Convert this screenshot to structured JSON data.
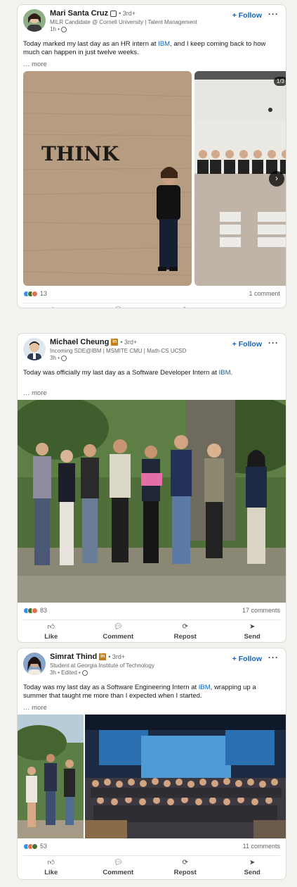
{
  "posts": [
    {
      "author": "Mari Santa Cruz",
      "degree": "• 3rd+",
      "headline": "MILR Candidate @ Cornell University | Talent Management",
      "time": "1h •",
      "follow_label": "+ Follow",
      "text_before": "Today marked my last day as an HR intern at ",
      "mention": "IBM",
      "text_after": ", and I keep coming back to how much can happen in just twelve weeks.",
      "see_more": "… more",
      "photo_sign_text": "THINK",
      "photo_counter": "1/3",
      "reactions_count": "13",
      "comments_count": "1 comment"
    },
    {
      "author": "Michael Cheung",
      "degree": "• 3rd+",
      "headline": "Incoming SDE@IBM | MSMITE CMU | Math-CS UCSD",
      "time": "3h •",
      "follow_label": "+ Follow",
      "text_before": "Today was officially my last day as a Software Developer Intern at ",
      "mention": "IBM",
      "text_after": ".",
      "see_more": "… more",
      "reactions_count": "83",
      "comments_count": "17 comments"
    },
    {
      "author": "Simrat Thind",
      "degree": "• 3rd+",
      "headline": "Student at Georgia Institute of Technology",
      "time": "3h • Edited •",
      "follow_label": "+ Follow",
      "text_before": "Today was my last day as a Software Engineering Intern at ",
      "mention": "IBM",
      "text_after": ", wrapping up a summer that taught me more than I expected when I started.",
      "see_more": "… more",
      "reactions_count": "53",
      "comments_count": "11 comments"
    }
  ],
  "actions": {
    "like": "Like",
    "comment": "Comment",
    "repost": "Repost",
    "send": "Send"
  },
  "colors": {
    "link": "#0a66c2",
    "like_reaction": "#378fe9",
    "celebrate_reaction": "#44712e",
    "love_reaction": "#df704d"
  }
}
